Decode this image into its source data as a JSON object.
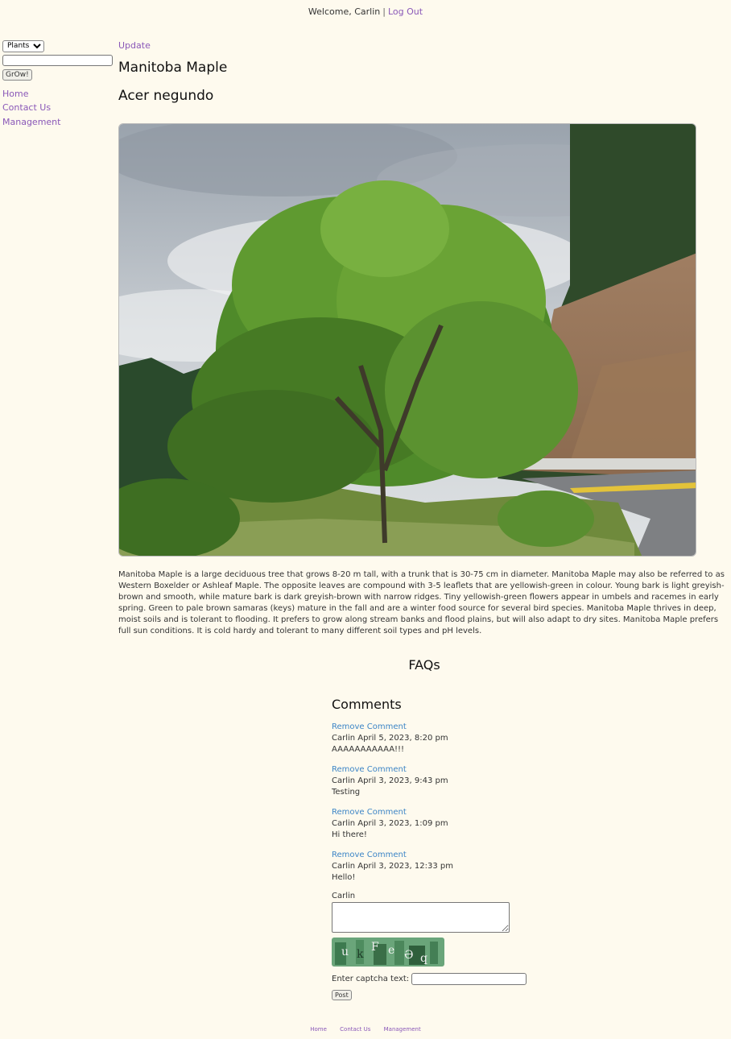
{
  "header": {
    "welcome_text": "Welcome, Carlin",
    "separator": "|",
    "logout_label": "Log Out"
  },
  "sidebar": {
    "category_select": "Plants",
    "search_value": "",
    "grow_button": "GrOw!",
    "nav": [
      "Home",
      "Contact Us",
      "Management"
    ]
  },
  "main": {
    "update_link": "Update",
    "common_name": "Manitoba Maple",
    "latin_name": "Acer negundo",
    "description": "Manitoba Maple is a large deciduous tree that grows 8-20 m tall, with a trunk that is 30-75 cm in diameter. Manitoba Maple may also be referred to as Western Boxelder or Ashleaf Maple. The opposite leaves are compound with 3-5 leaflets that are yellowish-green in colour. Young bark is light greyish-brown and smooth, while mature bark is dark greyish-brown with narrow ridges. Tiny yellowish-green flowers appear in umbels and racemes in early spring. Green to pale brown samaras (keys) mature in the fall and are a winter food source for several bird species. Manitoba Maple thrives in deep, moist soils and is tolerant to flooding. It prefers to grow along stream banks and flood plains, but will also adapt to dry sites. Manitoba Maple prefers full sun conditions. It is cold hardy and tolerant to many different soil types and pH levels."
  },
  "faqs_heading": "FAQs",
  "comments": {
    "heading": "Comments",
    "remove_label": "Remove Comment",
    "items": [
      {
        "meta": "Carlin April 5, 2023, 8:20 pm",
        "text": "AAAAAAAAAAA!!!"
      },
      {
        "meta": "Carlin April 3, 2023, 9:43 pm",
        "text": "Testing"
      },
      {
        "meta": "Carlin April 3, 2023, 1:09 pm",
        "text": "Hi there!"
      },
      {
        "meta": "Carlin April 3, 2023, 12:33 pm",
        "text": "Hello!"
      }
    ],
    "form": {
      "user": "Carlin",
      "captcha_chars": [
        "u",
        "k",
        "F",
        "e",
        "Ə",
        "q"
      ],
      "captcha_label": "Enter captcha text:",
      "post_button": "Post"
    }
  },
  "footer": [
    "Home",
    "Contact Us",
    "Management"
  ],
  "colors": {
    "background": "#fefaee",
    "link": "#8a58b8",
    "comment_link": "#3d85c6"
  }
}
